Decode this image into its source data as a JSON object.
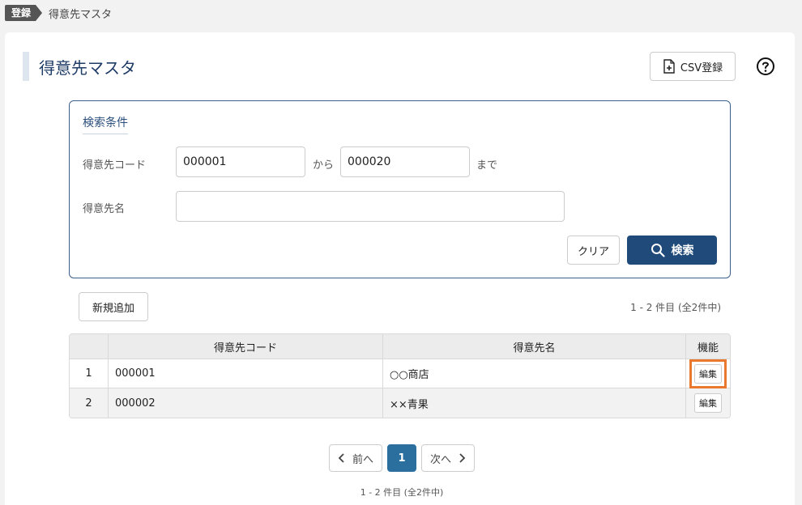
{
  "breadcrumb": {
    "tag": "登録",
    "current": "得意先マスタ"
  },
  "page": {
    "title": "得意先マスタ"
  },
  "toolbar": {
    "csv_label": "CSV登録",
    "help_icon": "help-circle-icon"
  },
  "search": {
    "heading": "検索条件",
    "code_label": "得意先コード",
    "code_from": "000001",
    "from_text": "から",
    "code_to": "000020",
    "to_text": "まで",
    "name_label": "得意先名",
    "name_value": "",
    "clear_label": "クリア",
    "search_label": "検索"
  },
  "actions": {
    "add_label": "新規追加"
  },
  "result_count": "1 - 2 件目 (全2件中)",
  "table": {
    "headers": [
      "",
      "得意先コード",
      "得意先名",
      "機能"
    ],
    "rows": [
      {
        "no": "1",
        "code": "000001",
        "name": "○○商店",
        "action": "編集"
      },
      {
        "no": "2",
        "code": "000002",
        "name": "××青果",
        "action": "編集"
      }
    ]
  },
  "pagination": {
    "prev": "前へ",
    "current": "1",
    "next": "次へ"
  },
  "colors": {
    "accent": "#1f4a7a",
    "page_active": "#2a6f9e",
    "highlight": "#e8792f"
  }
}
